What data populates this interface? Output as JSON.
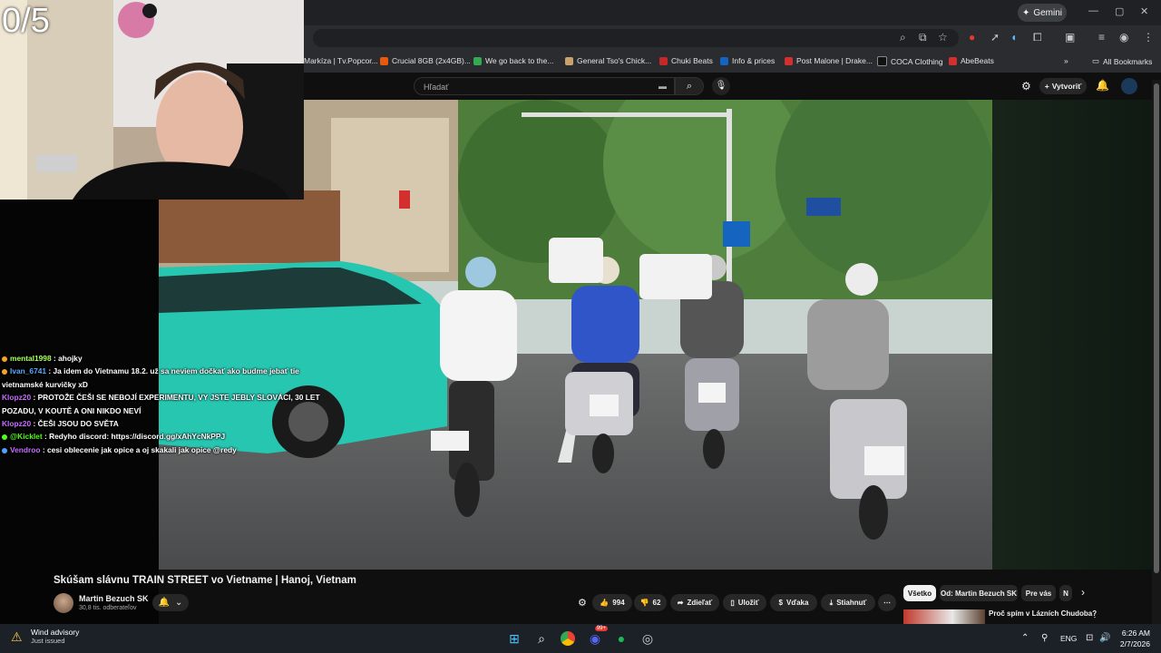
{
  "webcam": {
    "counter": "0/5"
  },
  "browser": {
    "gemini_label": "Gemini",
    "bookmarks": [
      {
        "label": "Markíza | Tv.Popcor...",
        "color": "#2d2d2d"
      },
      {
        "label": "Crucial 8GB (2x4GB)...",
        "color": "#e8590c"
      },
      {
        "label": "We go back to the...",
        "color": "#34a853"
      },
      {
        "label": "General Tso's Chick...",
        "color": "#c9a26b"
      },
      {
        "label": "Chuki Beats",
        "color": "#c62828"
      },
      {
        "label": "Info & prices",
        "color": "#1565c0"
      },
      {
        "label": "Post Malone | Drake...",
        "color": "#d32f2f"
      },
      {
        "label": "COCA Clothing",
        "color": "#111111"
      },
      {
        "label": "AbeBeats",
        "color": "#d32f2f"
      }
    ],
    "all_bookmarks": "All Bookmarks"
  },
  "youtube": {
    "search_placeholder": "Hľadať",
    "create_label": "Vytvoriť",
    "video_title": "Skúšam slávnu TRAIN STREET vo Vietname | Hanoj, Vietnam",
    "channel_name": "Martin Bezuch SK",
    "subscribers": "30,8 tis. odberateľov",
    "likes": "994",
    "dislikes": "62",
    "share": "Zdieľať",
    "save": "Uložiť",
    "thanks": "Vďaka",
    "download": "Stiahnuť",
    "chips": [
      "Všetko",
      "Od: Martin Bezuch SK",
      "Pre vás",
      "N"
    ],
    "rec_title": "Proč spím v Lázních Chudoba? | Probudowaté jste vy | Dražší"
  },
  "chat": [
    {
      "user": "mental1998",
      "color": "#a8ff60",
      "badge": "#f7a326",
      "text": ": ahojky"
    },
    {
      "user": "Ivan_6741",
      "color": "#5aa9ff",
      "badge": "#f7a326",
      "text": ": Ja idem do Vietnamu 18.2. už sa neviem dočkať ako budme jebať tie"
    },
    {
      "user": "",
      "color": "#ffffff",
      "badge": "",
      "text": "vietnamské kurvičky xD"
    },
    {
      "user": "Klopz20",
      "color": "#c86bff",
      "badge": "",
      "text": ": PROTOŽE ČEŠI SE NEBOJÍ EXPERIMENTU, VY JSTE JEBLY SLOVÁCI, 30 LET"
    },
    {
      "user": "",
      "color": "#ffffff",
      "badge": "",
      "text": "POZADU, V KOUTĚ A ONI NIKDO NEVÍ"
    },
    {
      "user": "Klopz20",
      "color": "#c86bff",
      "badge": "",
      "text": ": ČEŠI JSOU DO SVĚTA"
    },
    {
      "user": "@Kicklet",
      "color": "#53fc18",
      "badge": "#53fc18",
      "text": ": Redyho discord: https://discord.gg/xAhYcNkPPJ"
    },
    {
      "user": "Vendroo",
      "color": "#c86bff",
      "badge": "#4aa3ff",
      "text": ": cesi oblecenie jak opice a oj skakali jak opice @redy"
    }
  ],
  "taskbar": {
    "weather_title": "Wind advisory",
    "weather_sub": "Just issued",
    "lang": "ENG",
    "time": "6:26 AM",
    "date": "2/7/2026",
    "discord_badge": "99+"
  }
}
